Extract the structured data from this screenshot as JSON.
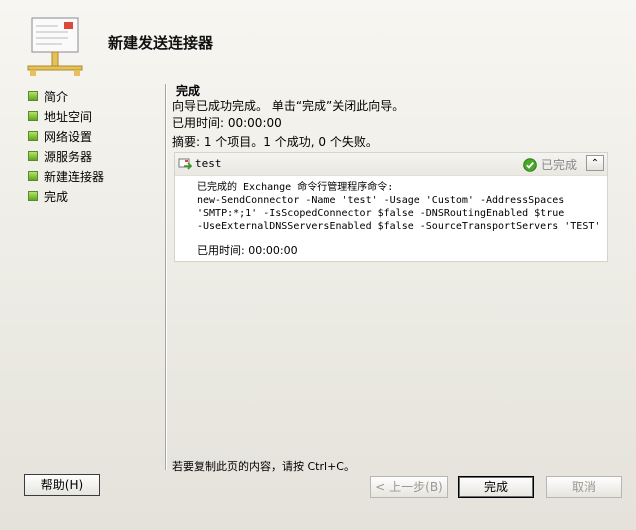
{
  "wizard": {
    "title": "新建发送连接器",
    "icon": "mail-connector-icon"
  },
  "nav": {
    "items": [
      {
        "label": "简介"
      },
      {
        "label": "地址空间"
      },
      {
        "label": "网络设置"
      },
      {
        "label": "源服务器"
      },
      {
        "label": "新建连接器"
      },
      {
        "label": "完成"
      }
    ],
    "bullet_color": "#6fb82a"
  },
  "main": {
    "section_title": "完成",
    "success_text": "向导已成功完成。 单击“完成”关闭此向导。",
    "elapsed_label": "已用时间: 00:00:00",
    "summary": "摘要: 1 个项目。1 个成功, 0 个失败。",
    "panel": {
      "name": "test",
      "status": "已完成",
      "command_header": "已完成的 Exchange 命令行管理程序命令:",
      "command_lines": [
        "new-SendConnector -Name 'test' -Usage 'Custom' -AddressSpaces",
        "'SMTP:*;1' -IsScopedConnector $false -DNSRoutingEnabled $true",
        "-UseExternalDNSServersEnabled $false -SourceTransportServers 'TEST'"
      ],
      "elapsed": "已用时间: 00:00:00"
    },
    "copy_hint": "若要复制此页的内容，请按 Ctrl+C。"
  },
  "buttons": {
    "help": "帮助(H)",
    "back": "< 上一步(B)",
    "finish": "完成",
    "cancel": "取消"
  }
}
